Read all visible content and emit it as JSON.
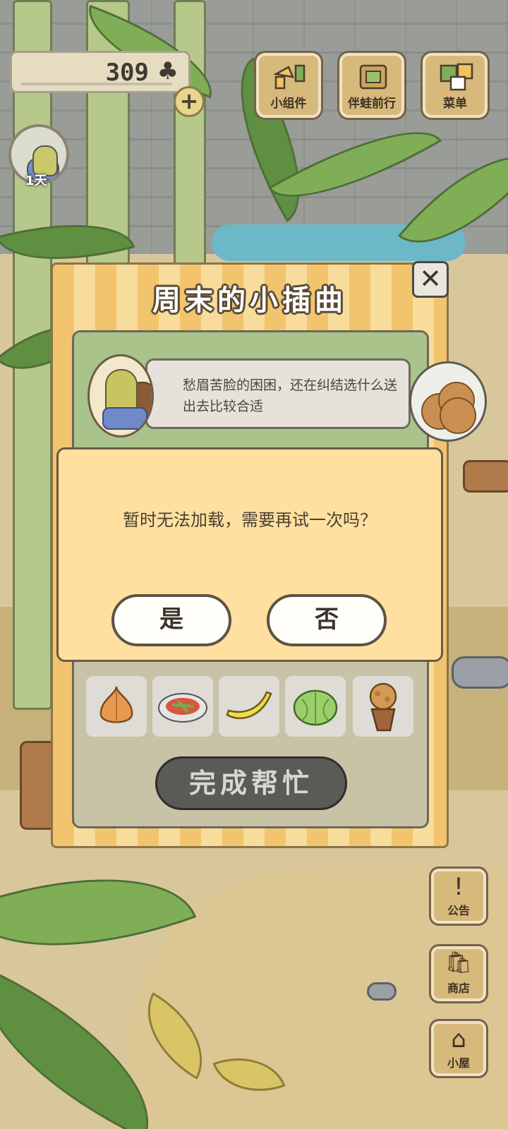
{
  "hud": {
    "clover_count": "309",
    "clover_icon": "clover-icon",
    "add_button": "+",
    "day_label": "1天"
  },
  "top_buttons": [
    {
      "label": "小组件",
      "icon": "widget-icon"
    },
    {
      "label": "伴蛙前行",
      "icon": "frog-journey-icon"
    },
    {
      "label": "菜单",
      "icon": "menu-icon"
    }
  ],
  "side_buttons": [
    {
      "label": "公告",
      "icon": "notice-icon",
      "glyph": "!"
    },
    {
      "label": "商店",
      "icon": "shop-icon",
      "glyph": "🛍"
    },
    {
      "label": "小屋",
      "icon": "house-icon",
      "glyph": "⌂"
    }
  ],
  "panel": {
    "title": "周末的小插曲",
    "close": "✕",
    "speech": "愁眉苦脸的困困，还在纠结选什么送出去比较合适",
    "items": [
      "onion",
      "salad",
      "banana",
      "cabbage",
      "bread-cone"
    ],
    "finish_button": "完成帮忙"
  },
  "dialog": {
    "message": "暂时无法加载，需要再试一次吗？",
    "yes": "是",
    "no": "否"
  },
  "colors": {
    "panel_stripe_a": "#f3c46e",
    "panel_stripe_b": "#f8dc9c",
    "dialog_bg": "#ffe0a0",
    "button_dark": "#5c5a57"
  }
}
